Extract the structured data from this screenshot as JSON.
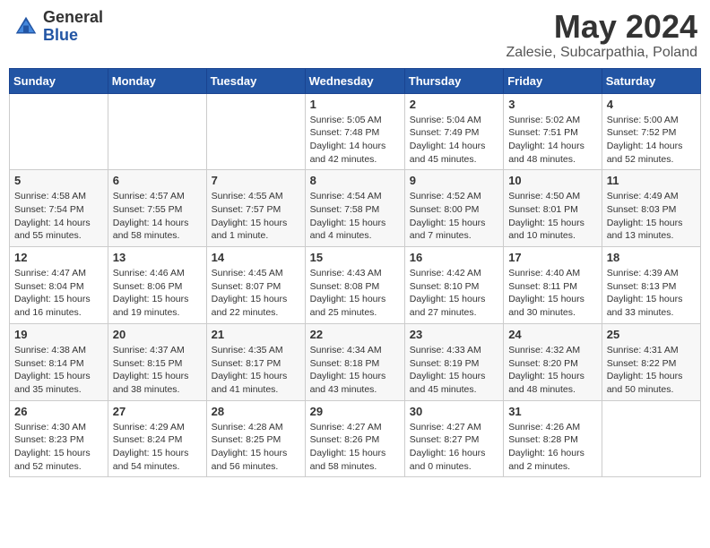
{
  "header": {
    "logo_general": "General",
    "logo_blue": "Blue",
    "month_title": "May 2024",
    "subtitle": "Zalesie, Subcarpathia, Poland"
  },
  "days_of_week": [
    "Sunday",
    "Monday",
    "Tuesday",
    "Wednesday",
    "Thursday",
    "Friday",
    "Saturday"
  ],
  "weeks": [
    [
      {
        "day": "",
        "sunrise": "",
        "sunset": "",
        "daylight": ""
      },
      {
        "day": "",
        "sunrise": "",
        "sunset": "",
        "daylight": ""
      },
      {
        "day": "",
        "sunrise": "",
        "sunset": "",
        "daylight": ""
      },
      {
        "day": "1",
        "sunrise": "Sunrise: 5:05 AM",
        "sunset": "Sunset: 7:48 PM",
        "daylight": "Daylight: 14 hours and 42 minutes."
      },
      {
        "day": "2",
        "sunrise": "Sunrise: 5:04 AM",
        "sunset": "Sunset: 7:49 PM",
        "daylight": "Daylight: 14 hours and 45 minutes."
      },
      {
        "day": "3",
        "sunrise": "Sunrise: 5:02 AM",
        "sunset": "Sunset: 7:51 PM",
        "daylight": "Daylight: 14 hours and 48 minutes."
      },
      {
        "day": "4",
        "sunrise": "Sunrise: 5:00 AM",
        "sunset": "Sunset: 7:52 PM",
        "daylight": "Daylight: 14 hours and 52 minutes."
      }
    ],
    [
      {
        "day": "5",
        "sunrise": "Sunrise: 4:58 AM",
        "sunset": "Sunset: 7:54 PM",
        "daylight": "Daylight: 14 hours and 55 minutes."
      },
      {
        "day": "6",
        "sunrise": "Sunrise: 4:57 AM",
        "sunset": "Sunset: 7:55 PM",
        "daylight": "Daylight: 14 hours and 58 minutes."
      },
      {
        "day": "7",
        "sunrise": "Sunrise: 4:55 AM",
        "sunset": "Sunset: 7:57 PM",
        "daylight": "Daylight: 15 hours and 1 minute."
      },
      {
        "day": "8",
        "sunrise": "Sunrise: 4:54 AM",
        "sunset": "Sunset: 7:58 PM",
        "daylight": "Daylight: 15 hours and 4 minutes."
      },
      {
        "day": "9",
        "sunrise": "Sunrise: 4:52 AM",
        "sunset": "Sunset: 8:00 PM",
        "daylight": "Daylight: 15 hours and 7 minutes."
      },
      {
        "day": "10",
        "sunrise": "Sunrise: 4:50 AM",
        "sunset": "Sunset: 8:01 PM",
        "daylight": "Daylight: 15 hours and 10 minutes."
      },
      {
        "day": "11",
        "sunrise": "Sunrise: 4:49 AM",
        "sunset": "Sunset: 8:03 PM",
        "daylight": "Daylight: 15 hours and 13 minutes."
      }
    ],
    [
      {
        "day": "12",
        "sunrise": "Sunrise: 4:47 AM",
        "sunset": "Sunset: 8:04 PM",
        "daylight": "Daylight: 15 hours and 16 minutes."
      },
      {
        "day": "13",
        "sunrise": "Sunrise: 4:46 AM",
        "sunset": "Sunset: 8:06 PM",
        "daylight": "Daylight: 15 hours and 19 minutes."
      },
      {
        "day": "14",
        "sunrise": "Sunrise: 4:45 AM",
        "sunset": "Sunset: 8:07 PM",
        "daylight": "Daylight: 15 hours and 22 minutes."
      },
      {
        "day": "15",
        "sunrise": "Sunrise: 4:43 AM",
        "sunset": "Sunset: 8:08 PM",
        "daylight": "Daylight: 15 hours and 25 minutes."
      },
      {
        "day": "16",
        "sunrise": "Sunrise: 4:42 AM",
        "sunset": "Sunset: 8:10 PM",
        "daylight": "Daylight: 15 hours and 27 minutes."
      },
      {
        "day": "17",
        "sunrise": "Sunrise: 4:40 AM",
        "sunset": "Sunset: 8:11 PM",
        "daylight": "Daylight: 15 hours and 30 minutes."
      },
      {
        "day": "18",
        "sunrise": "Sunrise: 4:39 AM",
        "sunset": "Sunset: 8:13 PM",
        "daylight": "Daylight: 15 hours and 33 minutes."
      }
    ],
    [
      {
        "day": "19",
        "sunrise": "Sunrise: 4:38 AM",
        "sunset": "Sunset: 8:14 PM",
        "daylight": "Daylight: 15 hours and 35 minutes."
      },
      {
        "day": "20",
        "sunrise": "Sunrise: 4:37 AM",
        "sunset": "Sunset: 8:15 PM",
        "daylight": "Daylight: 15 hours and 38 minutes."
      },
      {
        "day": "21",
        "sunrise": "Sunrise: 4:35 AM",
        "sunset": "Sunset: 8:17 PM",
        "daylight": "Daylight: 15 hours and 41 minutes."
      },
      {
        "day": "22",
        "sunrise": "Sunrise: 4:34 AM",
        "sunset": "Sunset: 8:18 PM",
        "daylight": "Daylight: 15 hours and 43 minutes."
      },
      {
        "day": "23",
        "sunrise": "Sunrise: 4:33 AM",
        "sunset": "Sunset: 8:19 PM",
        "daylight": "Daylight: 15 hours and 45 minutes."
      },
      {
        "day": "24",
        "sunrise": "Sunrise: 4:32 AM",
        "sunset": "Sunset: 8:20 PM",
        "daylight": "Daylight: 15 hours and 48 minutes."
      },
      {
        "day": "25",
        "sunrise": "Sunrise: 4:31 AM",
        "sunset": "Sunset: 8:22 PM",
        "daylight": "Daylight: 15 hours and 50 minutes."
      }
    ],
    [
      {
        "day": "26",
        "sunrise": "Sunrise: 4:30 AM",
        "sunset": "Sunset: 8:23 PM",
        "daylight": "Daylight: 15 hours and 52 minutes."
      },
      {
        "day": "27",
        "sunrise": "Sunrise: 4:29 AM",
        "sunset": "Sunset: 8:24 PM",
        "daylight": "Daylight: 15 hours and 54 minutes."
      },
      {
        "day": "28",
        "sunrise": "Sunrise: 4:28 AM",
        "sunset": "Sunset: 8:25 PM",
        "daylight": "Daylight: 15 hours and 56 minutes."
      },
      {
        "day": "29",
        "sunrise": "Sunrise: 4:27 AM",
        "sunset": "Sunset: 8:26 PM",
        "daylight": "Daylight: 15 hours and 58 minutes."
      },
      {
        "day": "30",
        "sunrise": "Sunrise: 4:27 AM",
        "sunset": "Sunset: 8:27 PM",
        "daylight": "Daylight: 16 hours and 0 minutes."
      },
      {
        "day": "31",
        "sunrise": "Sunrise: 4:26 AM",
        "sunset": "Sunset: 8:28 PM",
        "daylight": "Daylight: 16 hours and 2 minutes."
      },
      {
        "day": "",
        "sunrise": "",
        "sunset": "",
        "daylight": ""
      }
    ]
  ]
}
